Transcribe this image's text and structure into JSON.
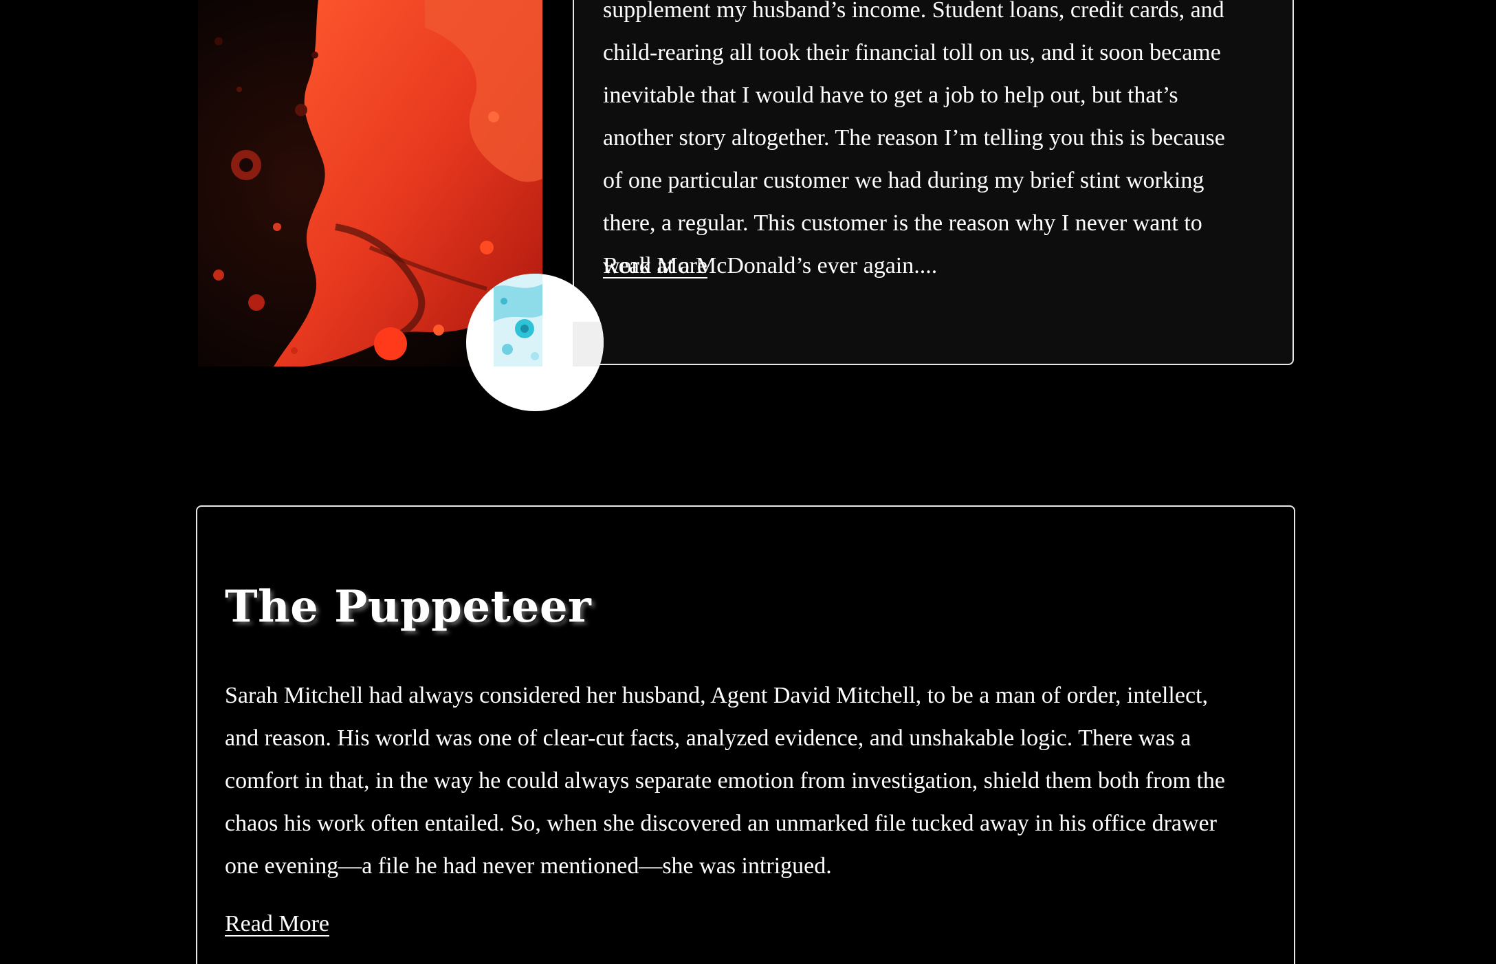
{
  "featured_story": {
    "excerpt_lines": [
      "supplement my husband’s income. Student loans, credit cards, and",
      "child-rearing all took their financial toll on us, and it soon became",
      "inevitable that I would have to get a job to help out, but that’s",
      "another story altogether. The reason I’m telling you this is because",
      "of one particular customer we had during my brief stint working",
      "there, a regular. This customer is the reason why I never want to",
      "work at a McDonald’s ever again...."
    ],
    "read_more_label": "Read More"
  },
  "story": {
    "title": "The Puppeteer",
    "excerpt_lines": [
      "Sarah Mitchell had always considered her husband, Agent David Mitchell, to be a man of order, intellect,",
      "and reason. His world was one of clear-cut facts, analyzed evidence, and unshakable logic. There was a",
      "comfort in that, in the way he could always separate emotion from investigation, shield them both from the",
      "chaos his work often entailed. So, when she discovered an unmarked file tucked away in his office drawer",
      "one evening—a file he had never mentioned—she was intrigued."
    ],
    "read_more_label": "Read More"
  },
  "colors": {
    "background": "#000000",
    "card_border": "#e8e8e8",
    "text": "#ffffff",
    "image_red": "#e8391f"
  }
}
